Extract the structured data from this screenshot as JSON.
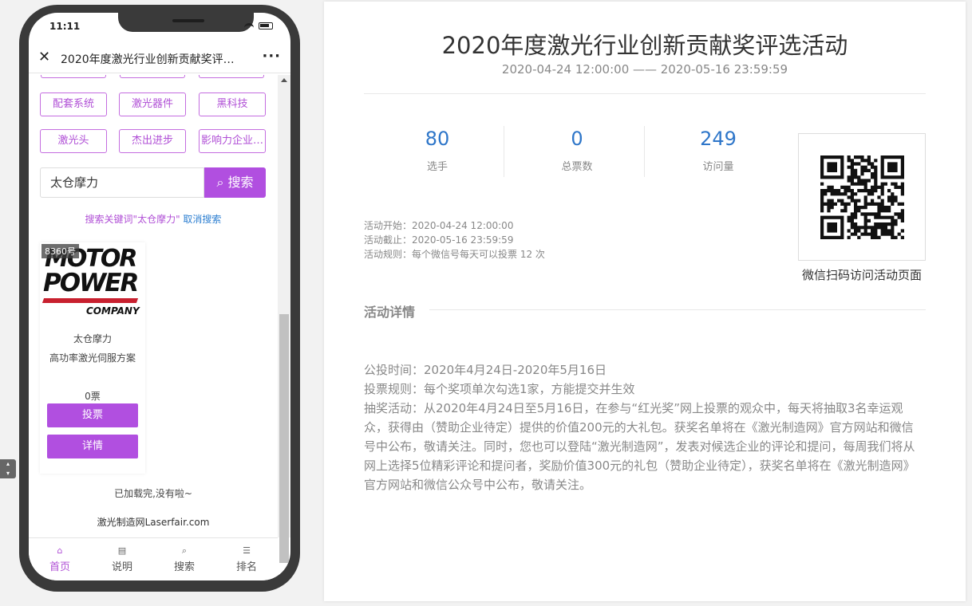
{
  "phone": {
    "status_time": "11:11",
    "nav_title": "2020年度激光行业创新贡献奖评…",
    "categories": [
      "配套系统",
      "激光器件",
      "黑科技",
      "激光头",
      "杰出进步",
      "影响力企业…"
    ],
    "search_value": "太仓摩力",
    "search_button": "搜索",
    "search_hint_key": "搜索关键词\"太仓摩力\"",
    "search_hint_cancel": "取消搜索",
    "card": {
      "badge": "8360号",
      "logo_line1": "MOTOR",
      "logo_line2": "POWER",
      "logo_company": "COMPANY",
      "name": "太仓摩力",
      "desc": "高功率激光伺服方案",
      "votes": "0票",
      "vote_button": "投票",
      "detail_button": "详情"
    },
    "loaded_text": "已加载完,没有啦~",
    "footer_site": "激光制造网Laserfair.com",
    "tabs": [
      {
        "label": "首页",
        "icon": "home-icon",
        "glyph": "⌂"
      },
      {
        "label": "说明",
        "icon": "document-icon",
        "glyph": "▤"
      },
      {
        "label": "搜索",
        "icon": "search-icon",
        "glyph": "⌕"
      },
      {
        "label": "排名",
        "icon": "list-icon",
        "glyph": "☰"
      }
    ]
  },
  "panel": {
    "title": "2020年度激光行业创新贡献奖评选活动",
    "daterange": "2020-04-24 12:00:00 —— 2020-05-16 23:59:59",
    "stats": [
      {
        "value": "80",
        "label": "选手"
      },
      {
        "value": "0",
        "label": "总票数"
      },
      {
        "value": "249",
        "label": "访问量"
      }
    ],
    "info": [
      "活动开始：2020-04-24 12:00:00",
      "活动截止：2020-05-16 23:59:59",
      "活动规则：每个微信号每天可以投票 12 次"
    ],
    "qr_caption": "微信扫码访问活动页面",
    "section_title": "活动详情",
    "detail_lines": [
      "公投时间：2020年4月24日-2020年5月16日",
      "投票规则：每个奖项单次勾选1家，方能提交并生效",
      "抽奖活动：从2020年4月24日至5月16日，在参与“红光奖”网上投票的观众中，每天将抽取3名幸运观众，获得由（赞助企业待定）提供的价值200元的大礼包。获奖名单将在《激光制造网》官方网站和微信号中公布，敬请关注。同时，您也可以登陆“激光制造网”，发表对候选企业的评论和提问，每周我们将从网上选择5位精彩评论和提问者，奖励价值300元的礼包（赞助企业待定），获奖名单将在《激光制造网》官方网站和微信公众号中公布，敬请关注。"
    ]
  },
  "colors": {
    "accent": "#b14fe0",
    "link": "#2e76c9"
  }
}
